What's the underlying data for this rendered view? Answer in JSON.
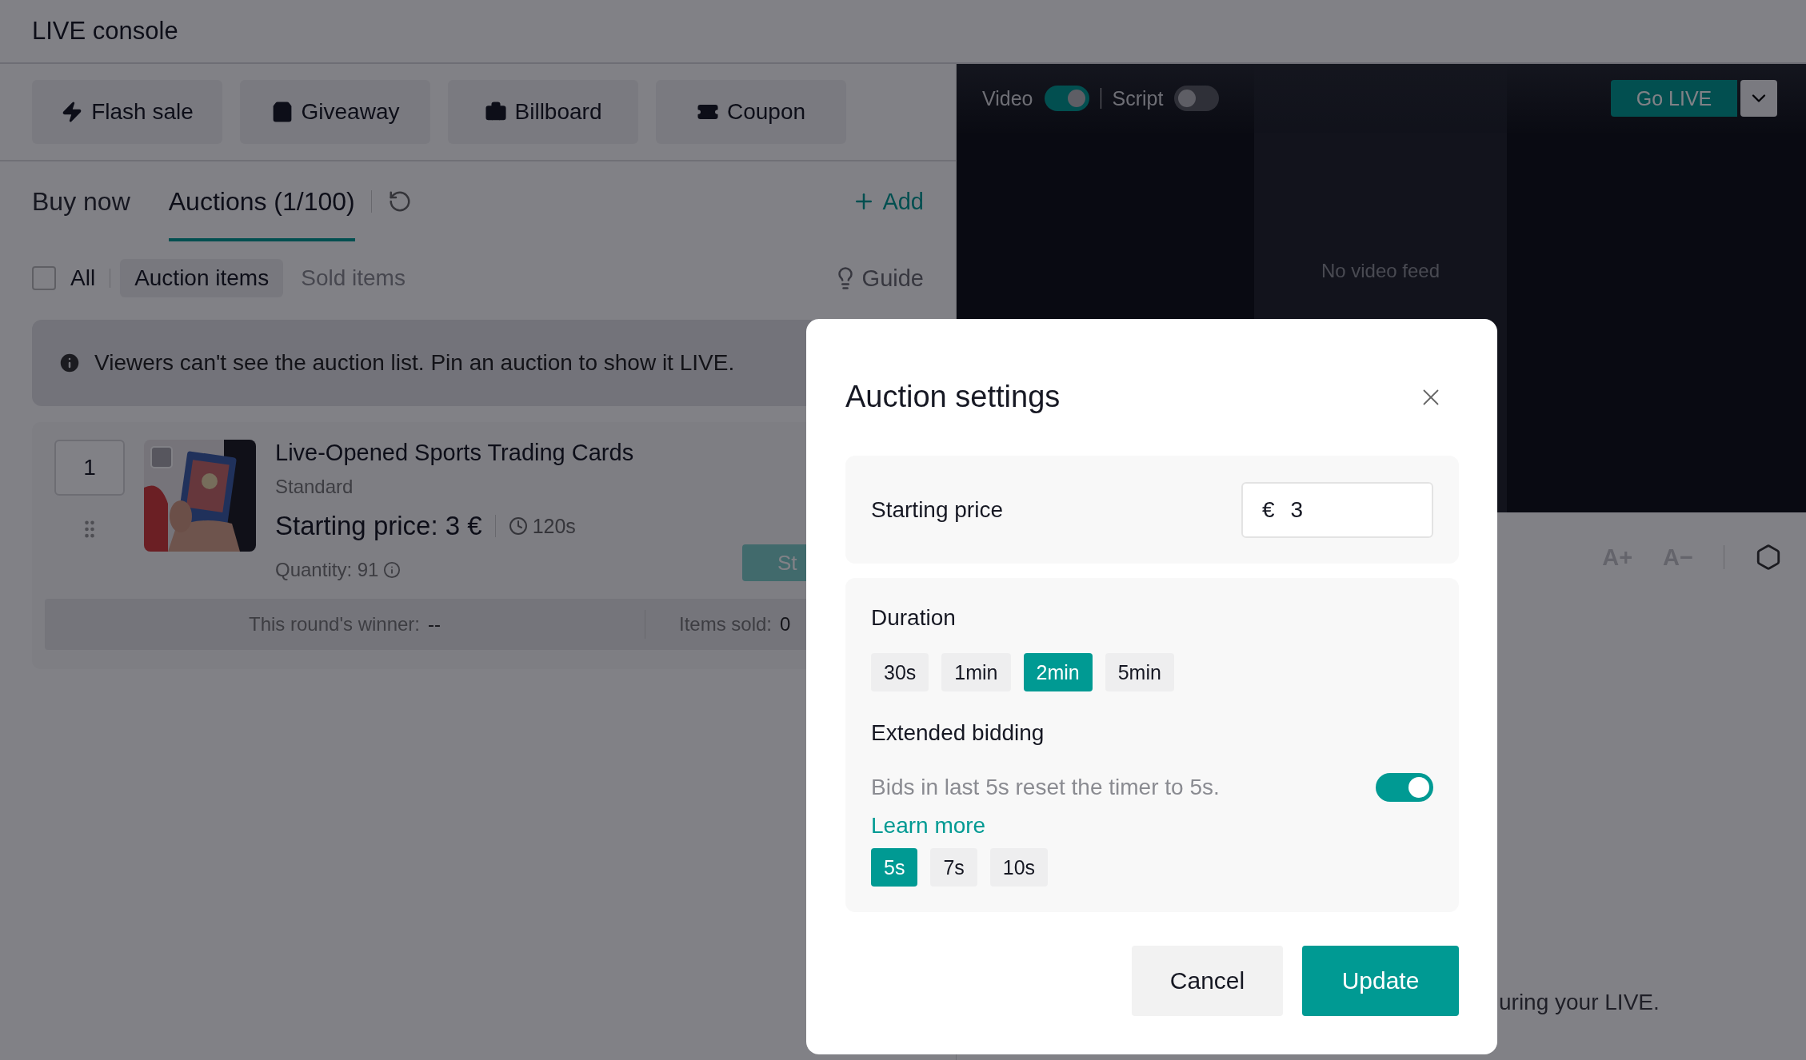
{
  "header": {
    "title": "LIVE console"
  },
  "tools": [
    {
      "label": "Flash sale",
      "kind": "flash"
    },
    {
      "label": "Giveaway",
      "kind": "giveaway"
    },
    {
      "label": "Billboard",
      "kind": "billboard"
    },
    {
      "label": "Coupon",
      "kind": "coupon"
    }
  ],
  "tabs": [
    {
      "label": "Buy now",
      "selected": false
    },
    {
      "label": "Auctions (1/100)",
      "selected": true
    }
  ],
  "add_label": "Add",
  "filters": {
    "all": {
      "label": "All",
      "checked": false
    },
    "items": [
      {
        "label": "Auction items",
        "selected": true
      },
      {
        "label": "Sold items",
        "selected": false
      }
    ],
    "guide": "Guide"
  },
  "banner": "Viewers can't see the auction list. Pin an auction to show it LIVE.",
  "auction": {
    "index": "1",
    "title": "Live-Opened Sports Trading Cards",
    "type": "Standard",
    "price": "Starting price: 3 €",
    "duration": "120s",
    "quantity": "Quantity: 91",
    "start_button": "St",
    "winner_label": "This round's winner:",
    "winner": "--",
    "sold_label": "Items sold:",
    "sold": "0",
    "checked": false
  },
  "video": {
    "toggles": [
      {
        "label": "Video",
        "on": true
      },
      {
        "label": "Script",
        "on": false
      }
    ],
    "go_live": "Go LIVE",
    "no_feed": "No video feed"
  },
  "script_tools": [
    "A+",
    "A−"
  ],
  "hint": "uring your LIVE.",
  "modal": {
    "title": "Auction settings",
    "price_label": "Starting price",
    "currency": "€",
    "price_value": "3",
    "duration_label": "Duration",
    "durations": [
      {
        "label": "30s",
        "selected": false
      },
      {
        "label": "1min",
        "selected": false
      },
      {
        "label": "2min",
        "selected": true
      },
      {
        "label": "5min",
        "selected": false
      }
    ],
    "extended_label": "Extended bidding",
    "extended_text": "Bids in last 5s reset the timer to 5s.",
    "extended_on": true,
    "learn_more": "Learn more",
    "extensions": [
      {
        "label": "5s",
        "selected": true
      },
      {
        "label": "7s",
        "selected": false
      },
      {
        "label": "10s",
        "selected": false
      }
    ],
    "cancel": "Cancel",
    "update": "Update"
  }
}
